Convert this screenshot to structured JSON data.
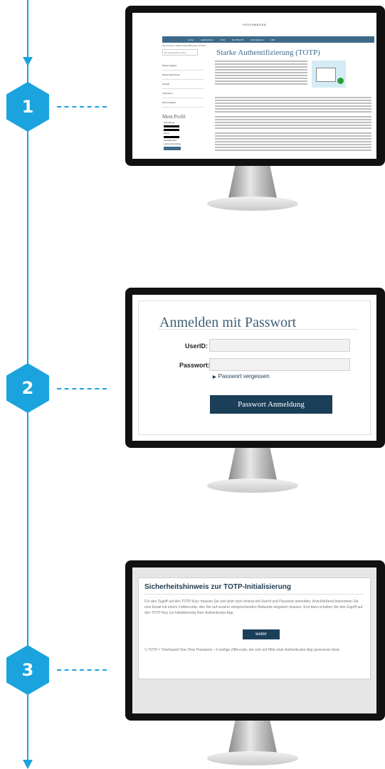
{
  "steps": [
    {
      "number": "1"
    },
    {
      "number": "2"
    },
    {
      "number": "3"
    }
  ],
  "screen1": {
    "logo_text": "VOLKSWAGEN",
    "nav_items": [
      "Home",
      "Applikationen",
      "FAQ",
      "EU-DSGVO",
      "Informationen",
      "Hilfe"
    ],
    "breadcrumb": "Sie sind hier: Starke Authentifizierung (TOTP)",
    "search_placeholder": "Mit Suchbegriff suchen",
    "page_title": "Starke Authentifizierung (TOTP)",
    "sidebar_items": [
      "Meine Angaben",
      "Meine Nachrichten",
      "Kontakt",
      "Impressum",
      "Mein Postfach"
    ],
    "profile_title": "Mein Profil",
    "profile_lines": [
      "Anmeldung",
      "Firma",
      "Werksbereich",
      "Letzte Anmeldung"
    ]
  },
  "screen2": {
    "title": "Anmelden mit Passwort",
    "userid_label": "UserID:",
    "password_label": "Passwort:",
    "forgot_link": "Passwort vergessen",
    "submit_label": "Passwort Anmeldung"
  },
  "screen3": {
    "title": "Sicherheitshinweis zur TOTP-Initialisierung",
    "body": "Für den Zugriff auf den TOTP-Key¹ müssen Sie sich jetzt noch einmal mit UserId und Passwort anmelden. Anschließend bekommen Sie eine Email mit einem Zahlencode, den Sie auf unserer entsprechenden Webseite eingeben müssen. Erst dann erhalten Sie den Zugriff auf den TOTP-Key zur Initialisierung Ihrer Authenticator App.",
    "button_label": "weiter",
    "footnote": "¹) TOTP = Timebased One-Time Password – 6-stellige Ziffercode, der sich mit Hilfe einer Authenticator App generieren lässt."
  }
}
